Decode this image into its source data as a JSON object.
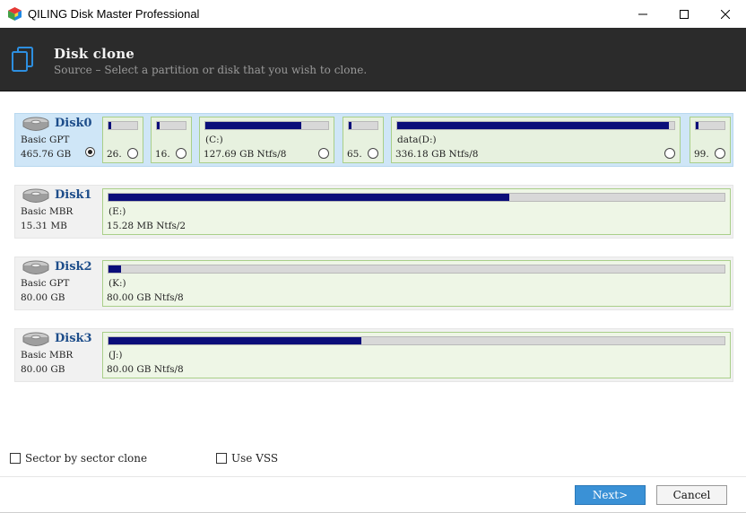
{
  "window": {
    "title": "QILING Disk Master Professional"
  },
  "header": {
    "title": "Disk clone",
    "subtitle": "Source – Select a partition or disk that you wish to clone."
  },
  "disks": [
    {
      "name": "Disk0",
      "type": "Basic GPT",
      "size": "465.76 GB",
      "selected": true,
      "partitions": [
        {
          "label": "",
          "info": "26.",
          "used": 0.08
        },
        {
          "label": "",
          "info": "16.",
          "used": 0.08
        },
        {
          "label": "(C:)",
          "info": "127.69 GB Ntfs/8",
          "used": 0.78
        },
        {
          "label": "",
          "info": "65.",
          "used": 0.1
        },
        {
          "label": "data(D:)",
          "info": "336.18 GB Ntfs/8",
          "used": 0.98
        },
        {
          "label": "",
          "info": "99.",
          "used": 0.1
        }
      ]
    },
    {
      "name": "Disk1",
      "type": "Basic MBR",
      "size": "15.31 MB",
      "selected": false,
      "partitions": [
        {
          "label": "(E:)",
          "info": "15.28 MB Ntfs/2",
          "used": 0.65
        }
      ]
    },
    {
      "name": "Disk2",
      "type": "Basic GPT",
      "size": "80.00 GB",
      "selected": false,
      "partitions": [
        {
          "label": "(K:)",
          "info": "80.00 GB Ntfs/8",
          "used": 0.02
        }
      ]
    },
    {
      "name": "Disk3",
      "type": "Basic MBR",
      "size": "80.00 GB",
      "selected": false,
      "partitions": [
        {
          "label": "(J:)",
          "info": "80.00 GB Ntfs/8",
          "used": 0.41
        }
      ]
    }
  ],
  "options": {
    "sector_clone": "Sector by sector clone",
    "use_vss": "Use VSS"
  },
  "buttons": {
    "next": "Next>",
    "cancel": "Cancel"
  },
  "colors": {
    "header_bg": "#2b2b2b",
    "selected_row": "#cfe6f7",
    "partition_fill": "#0b0e7a",
    "accent": "#3a91d6"
  }
}
